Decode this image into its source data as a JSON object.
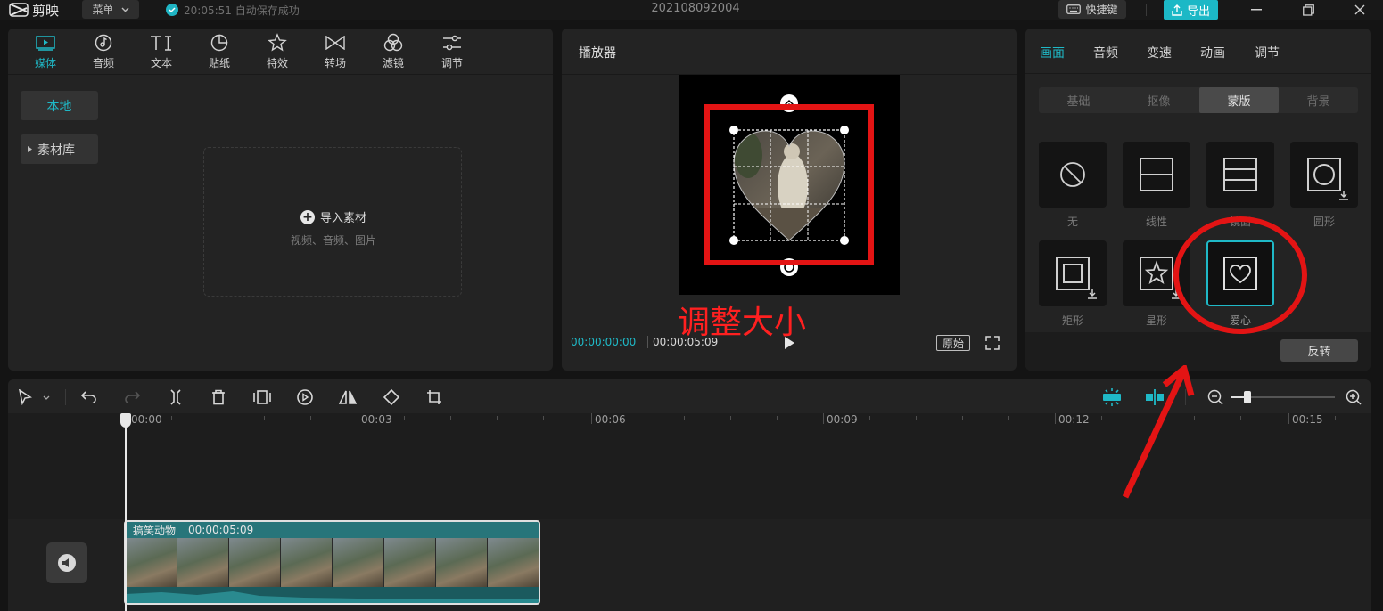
{
  "titlebar": {
    "app_name": "剪映",
    "menu_label": "菜单",
    "save_status": "20:05:51 自动保存成功",
    "project_title": "202108092004",
    "shortcut_label": "快捷键",
    "export_label": "导出"
  },
  "media_tabs": [
    {
      "label": "媒体",
      "icon": "media-icon"
    },
    {
      "label": "音频",
      "icon": "audio-icon"
    },
    {
      "label": "文本",
      "icon": "text-icon"
    },
    {
      "label": "贴纸",
      "icon": "sticker-icon"
    },
    {
      "label": "特效",
      "icon": "effects-icon"
    },
    {
      "label": "转场",
      "icon": "transition-icon"
    },
    {
      "label": "滤镜",
      "icon": "filter-icon"
    },
    {
      "label": "调节",
      "icon": "adjust-icon"
    }
  ],
  "sidebar": {
    "local_label": "本地",
    "library_label": "素材库"
  },
  "import": {
    "label": "导入素材",
    "hint": "视频、音频、图片"
  },
  "player": {
    "title": "播放器",
    "current_time": "00:00:00:00",
    "total_time": "00:00:05:09",
    "original_label": "原始"
  },
  "properties": {
    "tabs": [
      "画面",
      "音频",
      "变速",
      "动画",
      "调节"
    ],
    "sub_tabs": [
      "基础",
      "抠像",
      "蒙版",
      "背景"
    ],
    "masks": [
      {
        "label": "无",
        "icon": "none-mask-icon"
      },
      {
        "label": "线性",
        "icon": "linear-mask-icon"
      },
      {
        "label": "镜面",
        "icon": "mirror-mask-icon"
      },
      {
        "label": "圆形",
        "icon": "circle-mask-icon"
      },
      {
        "label": "矩形",
        "icon": "rectangle-mask-icon"
      },
      {
        "label": "星形",
        "icon": "star-mask-icon"
      },
      {
        "label": "爱心",
        "icon": "heart-mask-icon"
      }
    ],
    "invert_label": "反转"
  },
  "timeline": {
    "ruler_labels": [
      "00:00",
      "00:03",
      "00:06",
      "00:09",
      "00:12",
      "00:15"
    ],
    "clip_name": "搞笑动物",
    "clip_duration": "00:00:05:09"
  },
  "annotation": {
    "resize_note": "调整大小"
  },
  "colors": {
    "accent": "#1fb9c7",
    "annotation_red": "#e31414"
  }
}
